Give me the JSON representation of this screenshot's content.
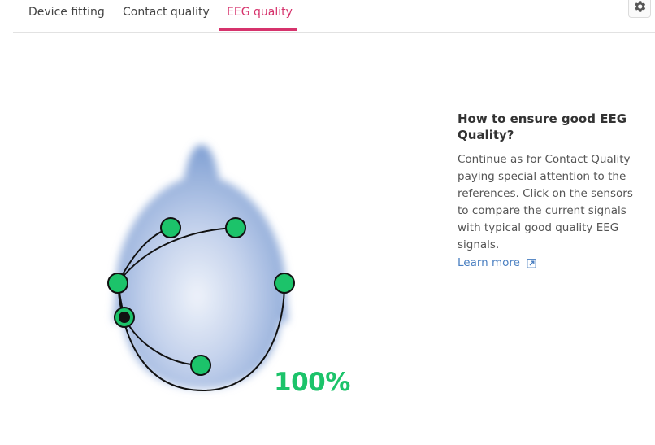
{
  "tabs": [
    {
      "label": "Device fitting",
      "active": false
    },
    {
      "label": "Contact quality",
      "active": false
    },
    {
      "label": "EEG quality",
      "active": true
    }
  ],
  "settings_icon": "gear-icon",
  "eeg_score": "100%",
  "info": {
    "title": "How to ensure good EEG Quality?",
    "body": "Continue as for Contact Quality paying special attention to the references. Click on the sensors to compare the current signals with typical good quality EEG signals.",
    "learn_more": "Learn more",
    "learn_more_icon": "external-link-icon"
  },
  "colors": {
    "accent": "#d6336c",
    "sensor_good": "#1cc36a",
    "score": "#1cc36a",
    "link": "#4a7fc1"
  }
}
